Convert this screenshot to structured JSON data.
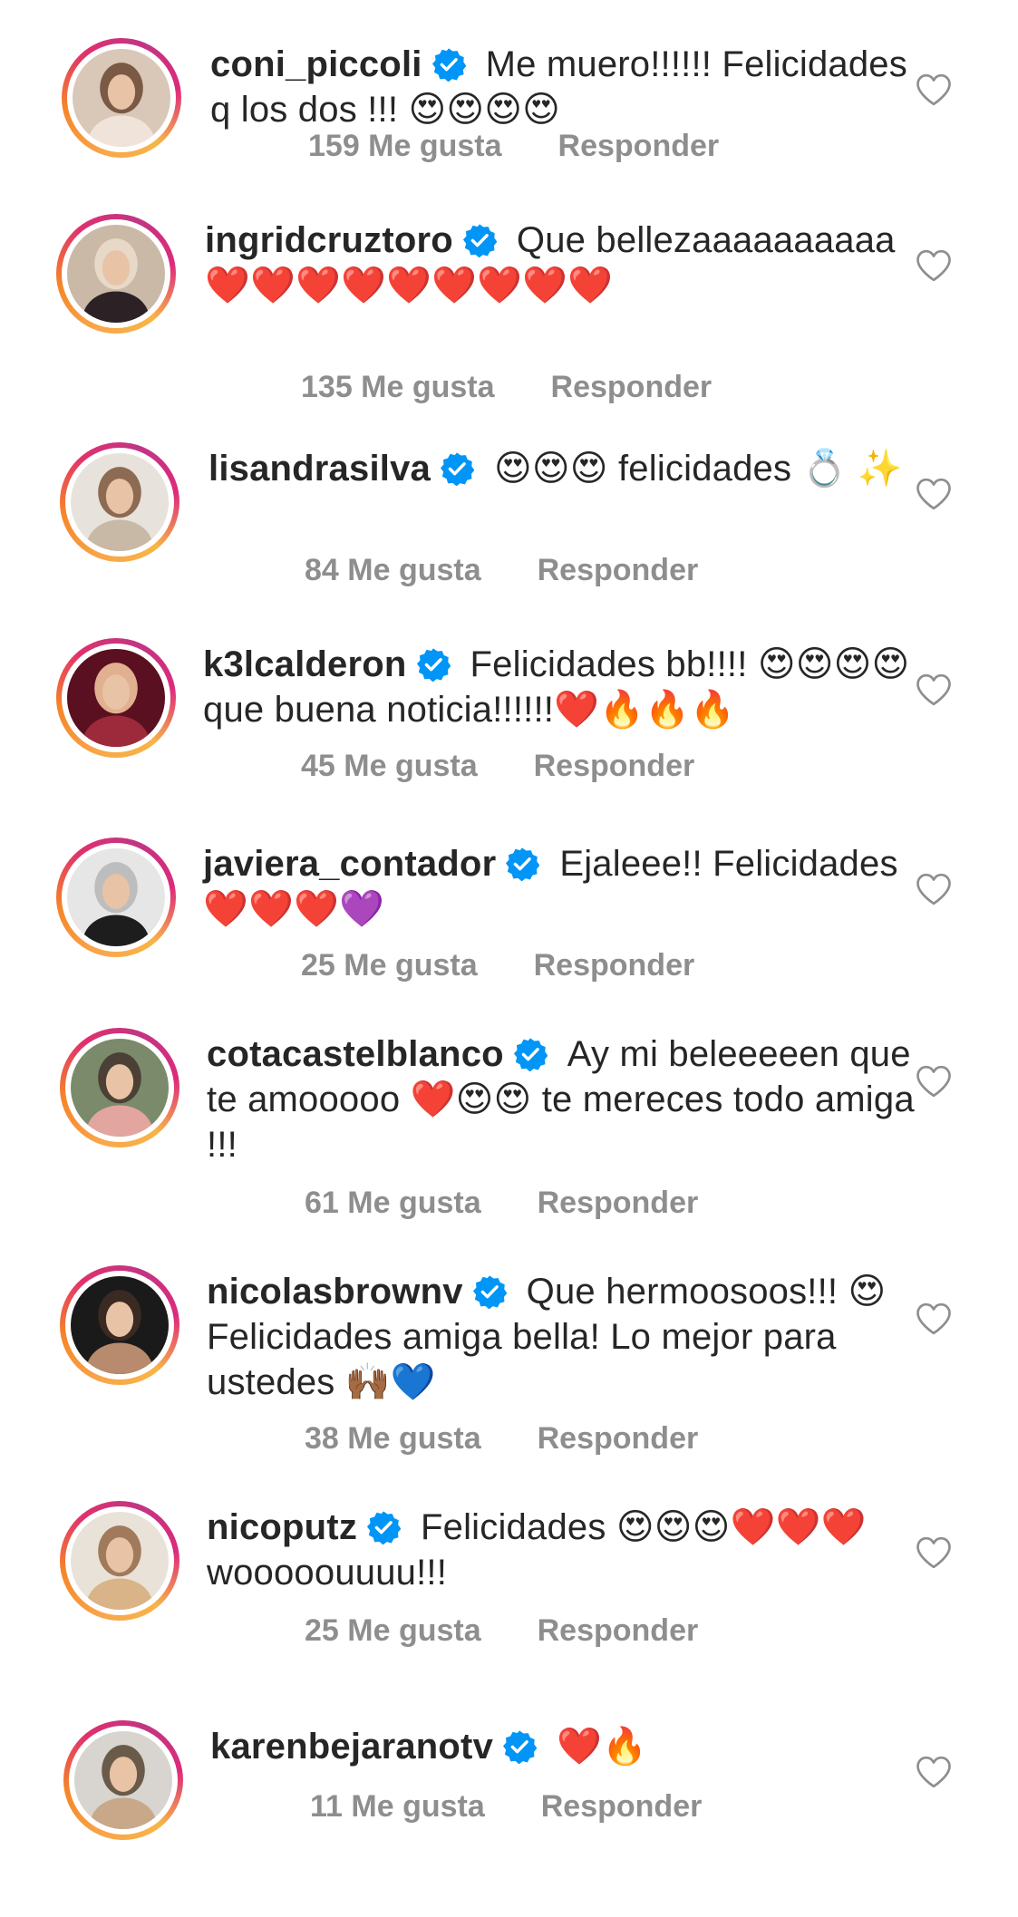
{
  "comments": [
    {
      "username": "coni_piccoli",
      "text": "Me muero!!!!!! Felicidades q los dos !!! 😍😍😍😍",
      "likes": "159 Me gusta",
      "reply": "Responder",
      "avatar_colors": [
        "#d9c8b8",
        "#f0e4da",
        "#7a5a44"
      ]
    },
    {
      "username": "ingridcruztoro",
      "text": "Que bellezaaaaaaaaaa❤️❤️❤️❤️❤️❤️❤️❤️❤️",
      "likes": "135 Me gusta",
      "reply": "Responder",
      "avatar_colors": [
        "#cbb9a8",
        "#2c2226",
        "#e8d8c8"
      ]
    },
    {
      "username": "lisandrasilva",
      "text": "😍😍😍 felicidades 💍 ✨",
      "likes": "84 Me gusta",
      "reply": "Responder",
      "avatar_colors": [
        "#e7e3dc",
        "#c8b9a6",
        "#8d6a52"
      ]
    },
    {
      "username": "k3lcalderon",
      "text": "Felicidades bb!!!! 😍😍😍😍 que buena noticia!!!!!!❤️🔥🔥🔥",
      "likes": "45 Me gusta",
      "reply": "Responder",
      "avatar_colors": [
        "#5a1020",
        "#9c2a3a",
        "#e0b090"
      ]
    },
    {
      "username": "javiera_contador",
      "text": "Ejaleee!! Felicidades ❤️❤️❤️💜",
      "likes": "25 Me gusta",
      "reply": "Responder",
      "avatar_colors": [
        "#e6e6e6",
        "#1d1d1d",
        "#bdbdbd"
      ]
    },
    {
      "username": "cotacastelblanco",
      "text": "Ay mi beleeeeen que te amooooo ❤️😍😍 te mereces todo amiga !!!",
      "likes": "61 Me gusta",
      "reply": "Responder",
      "avatar_colors": [
        "#7a8a6a",
        "#e3a5a0",
        "#4a4036"
      ]
    },
    {
      "username": "nicolasbrownv",
      "text": "Que hermoosoos!!! 😍 Felicidades amiga bella! Lo mejor para ustedes 🙌🏾💙",
      "likes": "38 Me gusta",
      "reply": "Responder",
      "avatar_colors": [
        "#1a1a1a",
        "#b88a6e",
        "#3a2a22"
      ]
    },
    {
      "username": "nicoputz",
      "text": "Felicidades 😍😍😍❤️❤️❤️ wooooouuuu!!!",
      "likes": "25 Me gusta",
      "reply": "Responder",
      "avatar_colors": [
        "#e9e2d8",
        "#d8b488",
        "#a07a5a"
      ]
    },
    {
      "username": "karenbejaranotv",
      "text": "❤️🔥",
      "likes": "11 Me gusta",
      "reply": "Responder",
      "avatar_colors": [
        "#d8d4cf",
        "#c8a888",
        "#6a5a4a"
      ]
    }
  ],
  "colors": {
    "text": "#262626",
    "meta": "#8e8e8e",
    "verified": "#0095f6",
    "ring_start": "#f58529",
    "ring_end": "#dd2a7b"
  },
  "icons": {
    "verified": "verified-badge-icon",
    "like": "heart-outline-icon"
  }
}
